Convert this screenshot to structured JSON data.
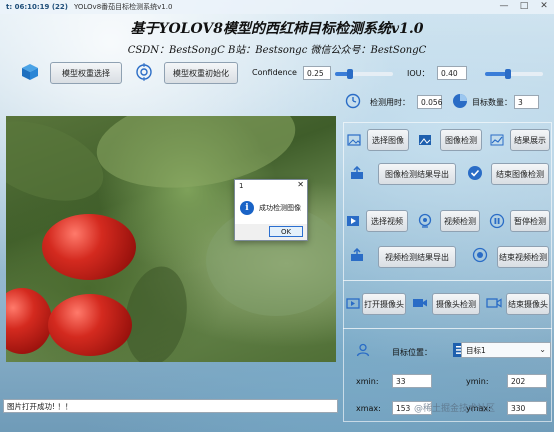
{
  "window": {
    "title_clock": "t: 06:10:19 (22)",
    "title": "YOLOv8番茄目标检测系统v1.0",
    "controls": {
      "minimize": "—",
      "maximize": "□",
      "close": "✕"
    }
  },
  "header": {
    "title": "基于YOLOV8模型的西红柿目标检测系统v1.0",
    "subtitle": "CSDN：BestSongC   B站：Bestsongc   微信公众号：BestSongC"
  },
  "toolbar": {
    "select_weights_label": "模型权重选择",
    "init_weights_label": "模型权重初始化",
    "confidence_label": "Confidence",
    "confidence_value": "0.25",
    "confidence_fraction": 0.25,
    "iou_label": "IOU：",
    "iou_value": "0.40",
    "iou_fraction": 0.4
  },
  "stats": {
    "time_label": "检测用时：",
    "time_value": "0.056",
    "count_label": "目标数量：",
    "count_value": "3"
  },
  "image_controls": {
    "select_image": "选择图像",
    "detect_image": "图像检测",
    "show_result": "结果展示",
    "export_image_result": "图像检测结果导出",
    "end_image_detection": "结束图像检测"
  },
  "video_controls": {
    "select_video": "选择视频",
    "detect_video": "视频检测",
    "pause_detect": "暂停检测",
    "export_video_result": "视频检测结果导出",
    "end_video_detection": "结束视频检测"
  },
  "camera_controls": {
    "open_camera": "打开摄像头",
    "camera_detect": "摄像头检测",
    "end_camera": "结束摄像头"
  },
  "target": {
    "position_label": "目标位置：",
    "selected": "目标1",
    "xmin_label": "xmin:",
    "xmin_value": "33",
    "ymin_label": "ymin:",
    "ymin_value": "202",
    "xmax_label": "xmax:",
    "xmax_value": "153",
    "ymax_label": "ymax:",
    "ymax_value": "330"
  },
  "dialog": {
    "title": "1",
    "message": "成功检测图像",
    "ok": "OK",
    "close": "✕"
  },
  "status": {
    "message": "图片打开成功! ！！"
  },
  "watermark": "@稀土掘金技术社区",
  "colors": {
    "accent": "#3a7dd8",
    "tomato": "#d42a1f",
    "info_icon": "#1a63c6"
  }
}
